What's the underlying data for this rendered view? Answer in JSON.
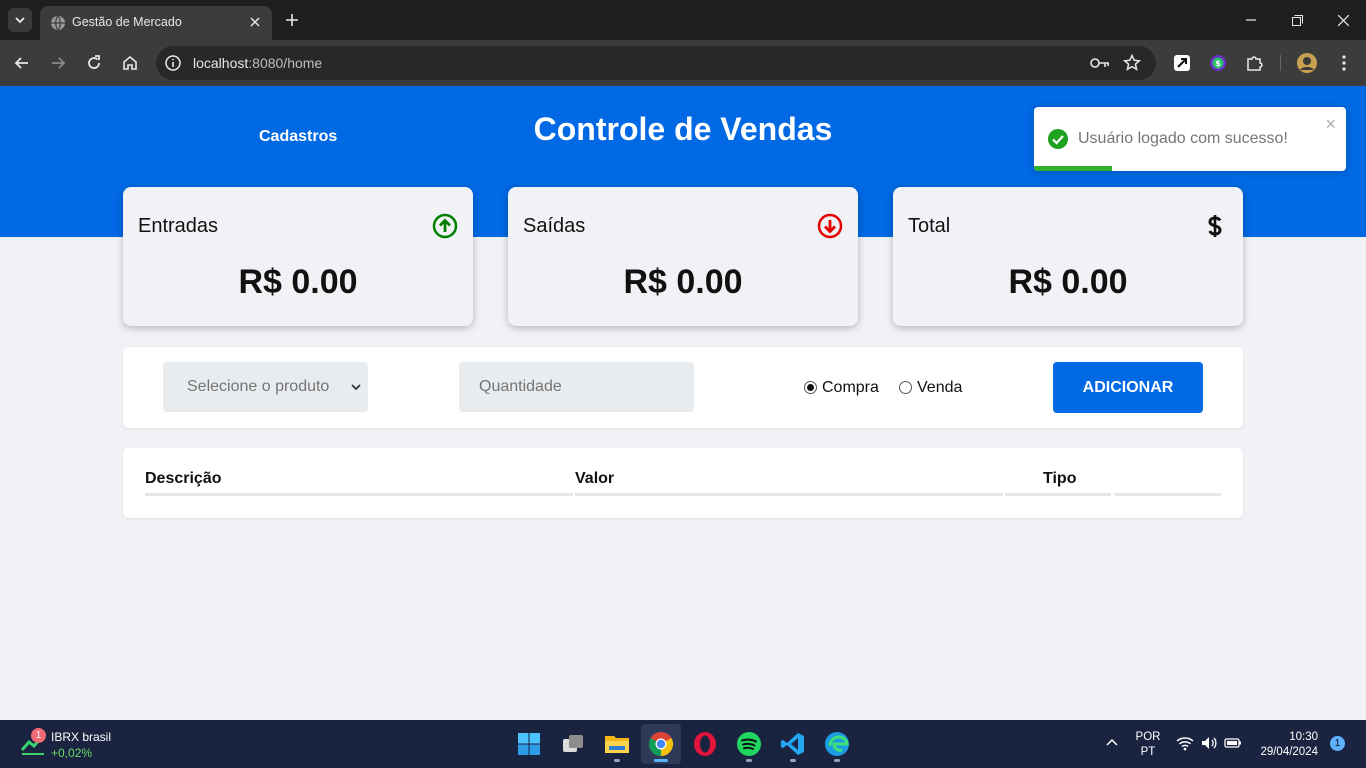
{
  "browser": {
    "tab_title": "Gestão de Mercado",
    "url_host": "localhost",
    "url_rest": ":8080/home"
  },
  "app": {
    "nav_link": "Cadastros",
    "title": "Controle de Vendas",
    "cards": [
      {
        "label": "Entradas",
        "value": "R$ 0.00",
        "icon": "arrow-up-circle-icon",
        "color": "#008000"
      },
      {
        "label": "Saídas",
        "value": "R$ 0.00",
        "icon": "arrow-down-circle-icon",
        "color": "#e60000"
      },
      {
        "label": "Total",
        "value": "R$ 0.00",
        "icon": "dollar-icon",
        "color": "#000000"
      }
    ],
    "form": {
      "product_placeholder": "Selecione o produto",
      "quantity_placeholder": "Quantidade",
      "radio_compra": "Compra",
      "radio_venda": "Venda",
      "selected_type": "Compra",
      "add_button": "ADICIONAR"
    },
    "table": {
      "headers": [
        "Descrição",
        "Valor",
        "Tipo",
        ""
      ]
    },
    "toast": {
      "message": "Usuário logado com sucesso!",
      "close": "×",
      "progress": 0.25
    },
    "accent_color": "#0069e3"
  },
  "taskbar": {
    "ticker_name": "IBRX brasil",
    "ticker_change": "+0,02%",
    "weather_badge": "1",
    "lang_line1": "POR",
    "lang_line2": "PT",
    "time": "10:30",
    "date": "29/04/2024",
    "notifications": "1"
  }
}
